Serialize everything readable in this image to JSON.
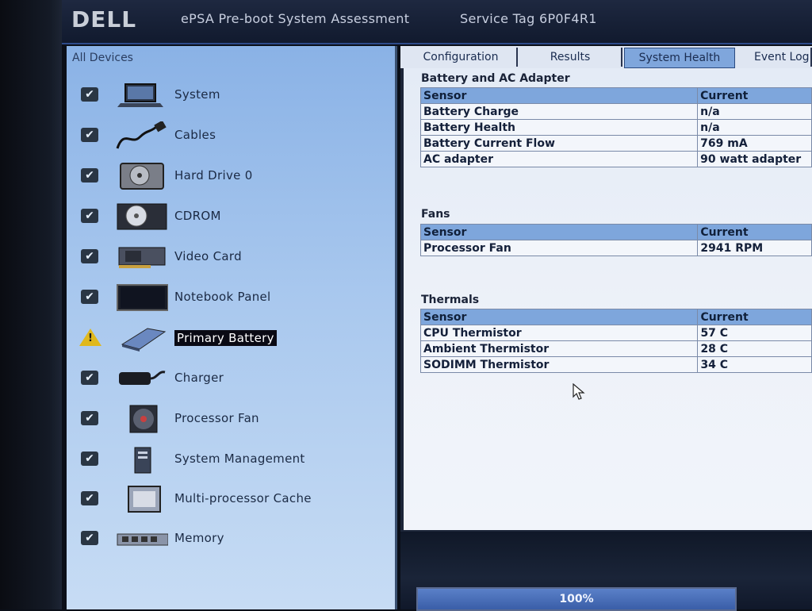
{
  "header": {
    "logo": "DELL",
    "title": "ePSA Pre-boot System Assessment",
    "service_tag": "Service Tag 6P0F4R1"
  },
  "devices": {
    "title": "All Devices",
    "items": [
      {
        "label": "System",
        "status": "checked",
        "icon": "laptop-icon"
      },
      {
        "label": "Cables",
        "status": "checked",
        "icon": "cable-icon"
      },
      {
        "label": "Hard Drive 0",
        "status": "checked",
        "icon": "hard-drive-icon"
      },
      {
        "label": "CDROM",
        "status": "checked",
        "icon": "cdrom-icon"
      },
      {
        "label": "Video Card",
        "status": "checked",
        "icon": "video-card-icon"
      },
      {
        "label": "Notebook Panel",
        "status": "checked",
        "icon": "notebook-panel-icon"
      },
      {
        "label": "Primary Battery",
        "status": "warning",
        "icon": "battery-icon",
        "selected": true
      },
      {
        "label": "Charger",
        "status": "checked",
        "icon": "charger-icon"
      },
      {
        "label": "Processor Fan",
        "status": "checked",
        "icon": "fan-icon"
      },
      {
        "label": "System Management",
        "status": "checked",
        "icon": "system-management-icon"
      },
      {
        "label": "Multi-processor Cache",
        "status": "checked",
        "icon": "processor-icon"
      },
      {
        "label": "Memory",
        "status": "checked",
        "icon": "memory-icon"
      }
    ]
  },
  "tabs": [
    {
      "label": "Configuration",
      "active": false
    },
    {
      "label": "Results",
      "active": false
    },
    {
      "label": "System Health",
      "active": true
    },
    {
      "label": "Event Log",
      "active": false
    }
  ],
  "battery": {
    "title": "Battery and AC Adapter",
    "headers": [
      "Sensor",
      "Current"
    ],
    "rows": [
      [
        "Battery Charge",
        "n/a"
      ],
      [
        "Battery Health",
        "n/a"
      ],
      [
        "Battery Current Flow",
        "769 mA"
      ],
      [
        "AC adapter",
        "90 watt adapter"
      ]
    ]
  },
  "fans": {
    "title": "Fans",
    "headers": [
      "Sensor",
      "Current"
    ],
    "rows": [
      [
        "Processor Fan",
        "2941 RPM"
      ]
    ]
  },
  "thermals": {
    "title": "Thermals",
    "headers": [
      "Sensor",
      "Current"
    ],
    "rows": [
      [
        "CPU Thermistor",
        "57 C"
      ],
      [
        "Ambient Thermistor",
        "28 C"
      ],
      [
        "SODIMM Thermistor",
        "34 C"
      ]
    ]
  },
  "progress": {
    "label": "100%",
    "value": 100
  },
  "colors": {
    "accent": "#7ea6dc",
    "warning": "#e0b81c",
    "selected_bg": "#0a0a14"
  }
}
